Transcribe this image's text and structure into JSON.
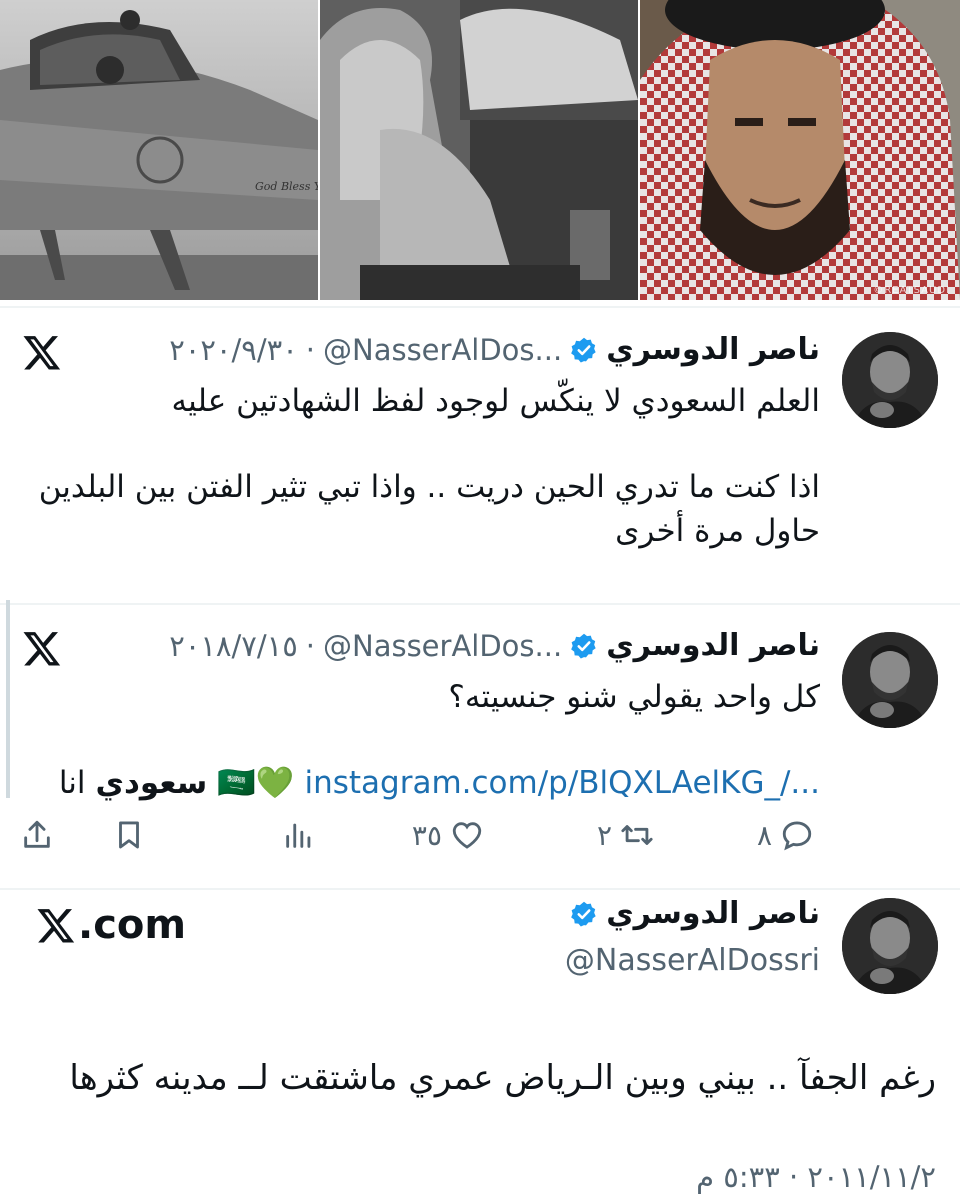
{
  "images": {
    "photo_1": {
      "alt": "fighter-jet",
      "watermark": ""
    },
    "photo_2": {
      "alt": "officials-at-table",
      "watermark": ""
    },
    "photo_3": {
      "alt": "portrait-with-headdress",
      "watermark": "©REATSAUDI"
    }
  },
  "tweet_1": {
    "name": "ناصر الدوسري",
    "handle": "@NasserAlDos...",
    "separator": "·",
    "date": "٢٠٢٠/٩/٣٠",
    "lines": [
      "العلم السعودي لا ينكّس لوجود لفظ الشهادتين عليه",
      "اذا كنت ما تدري الحين دريت .. واذا تبي تثير الفتن بين البلدين",
      "حاول مرة أخرى"
    ]
  },
  "tweet_2": {
    "name": "ناصر الدوسري",
    "handle": "@NasserAlDos...",
    "separator": "·",
    "date": "٢٠١٨/٧/١٥",
    "line_1": "كل واحد يقولي شنو جنسيته؟",
    "line_2_prefix": "انا",
    "line_2_bold": "سعودي",
    "line_2_emoji": "🇸🇦💚",
    "link": "instagram.com/p/BlQXLAelKG_/...",
    "actions": {
      "replies": "٨",
      "retweets": "٢",
      "likes": "٣٥"
    }
  },
  "tweet_3": {
    "site": ".com",
    "name": "ناصر الدوسري",
    "handle": "@NasserAlDossri",
    "text": "رغم الجفآ .. بيني وبين الـرياض عمري ماشتقت لــ مدينه كثرها",
    "date": "٢٠١١/١١/٢ · ٥:٣٣ م"
  },
  "colors": {
    "text": "#0f1419",
    "secondary": "#536471",
    "link": "#1d6fb0",
    "verified": "#1d9bf0",
    "divider": "#eff3f4"
  }
}
